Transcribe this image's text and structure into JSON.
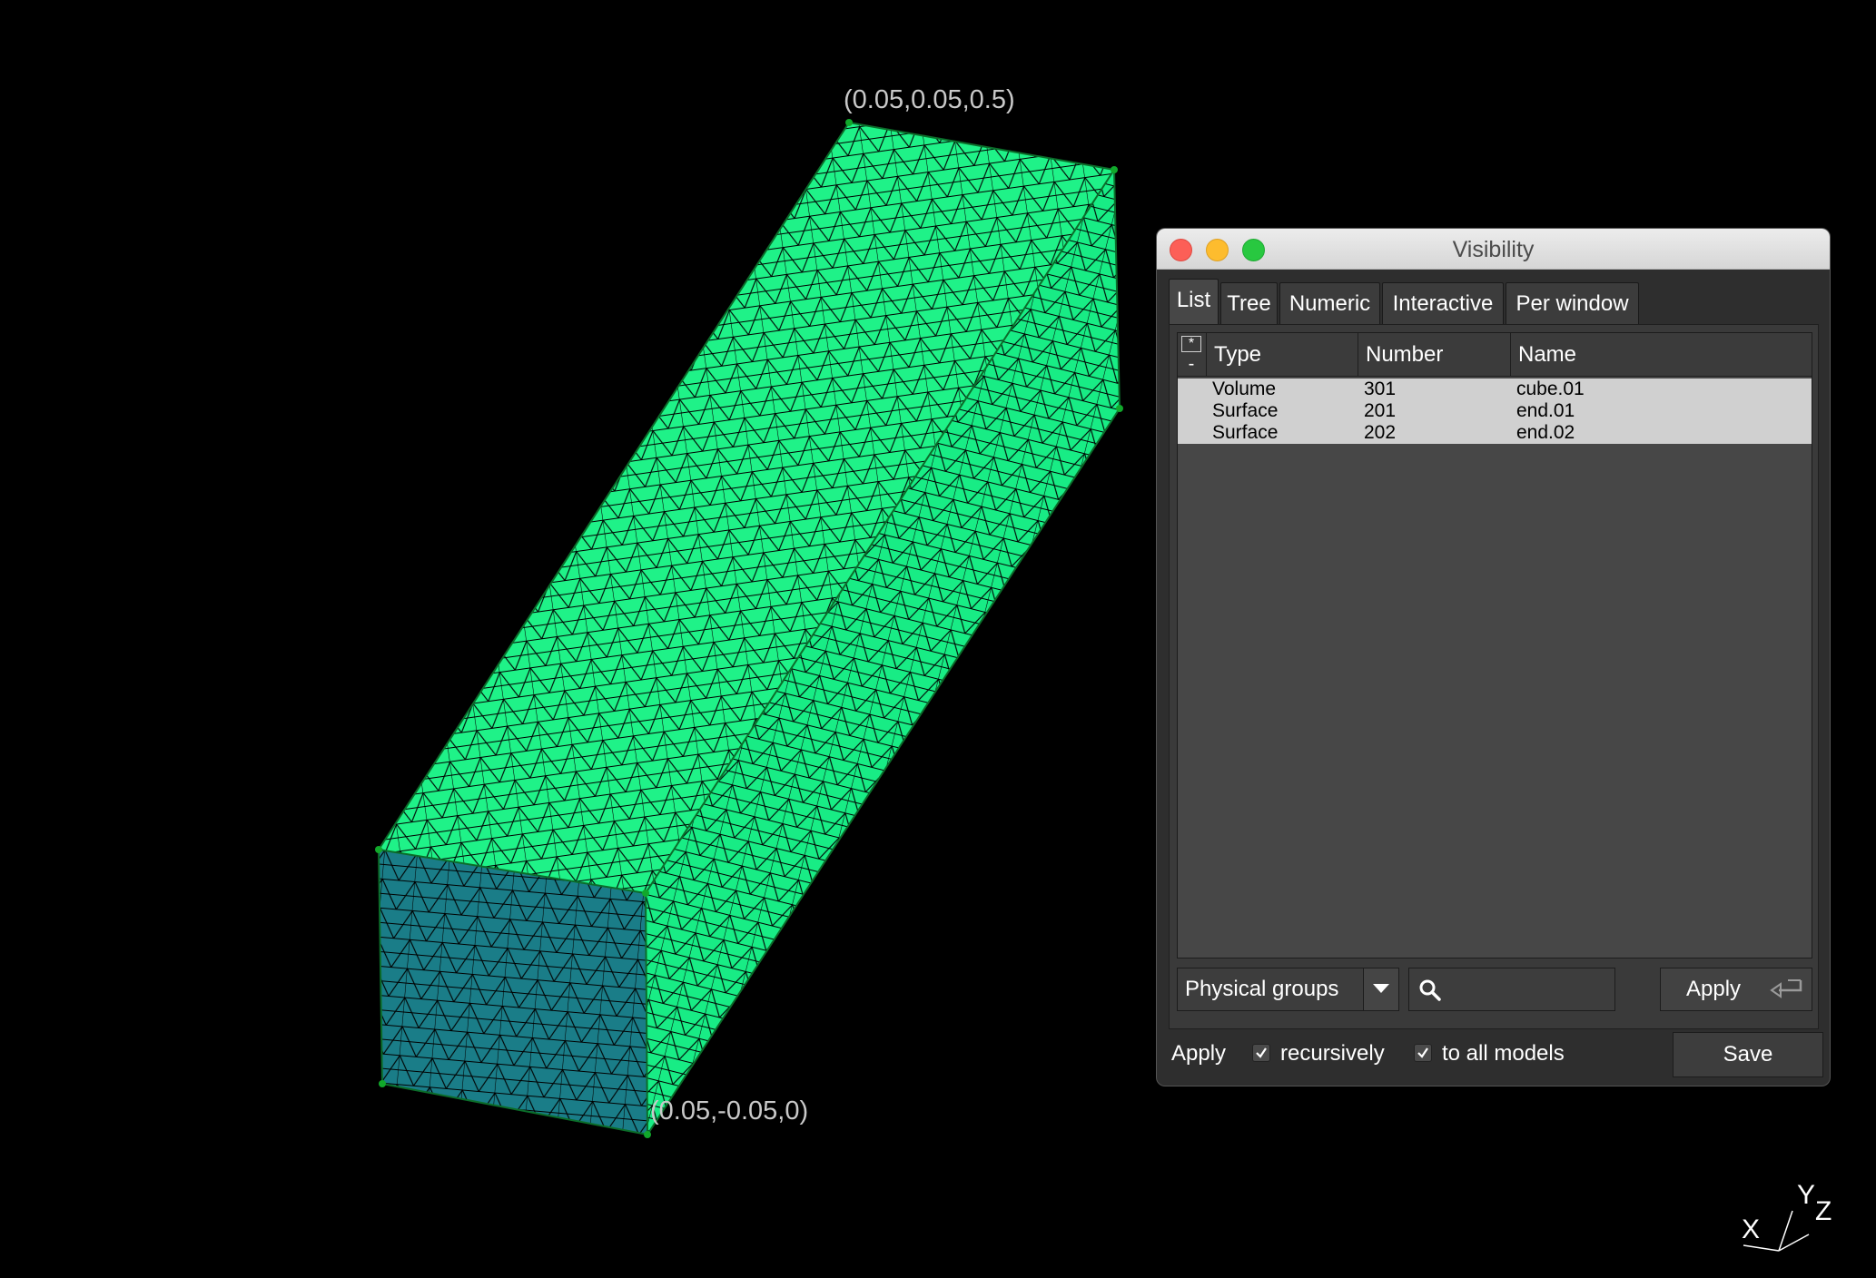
{
  "viewport": {
    "label_top": "(0.05,0.05,0.5)",
    "label_bottom": "(0.05,-0.05,0)",
    "axis_x": "X",
    "axis_y": "Y",
    "axis_z": "Z",
    "colors": {
      "top_face": "#1ff288",
      "side_face": "#18ec85",
      "front_face": "#1a7d88",
      "mesh_line": "#000000"
    }
  },
  "window": {
    "title": "Visibility",
    "tabs": [
      "List",
      "Tree",
      "Numeric",
      "Interactive",
      "Per window"
    ],
    "active_tab": "List",
    "list": {
      "toggle_plus": "*",
      "toggle_minus": "-",
      "headers": [
        "Type",
        "Number",
        "Name"
      ],
      "rows": [
        {
          "type": "Volume",
          "number": "301",
          "name": "cube.01"
        },
        {
          "type": "Surface",
          "number": "201",
          "name": "end.01"
        },
        {
          "type": "Surface",
          "number": "202",
          "name": "end.02"
        }
      ]
    },
    "group_choice": "Physical groups",
    "search_placeholder": "",
    "apply_button": "Apply",
    "apply_label": "Apply",
    "recursively_label": "recursively",
    "recursively_checked": true,
    "all_models_label": "to all models",
    "all_models_checked": true,
    "save_button": "Save"
  }
}
